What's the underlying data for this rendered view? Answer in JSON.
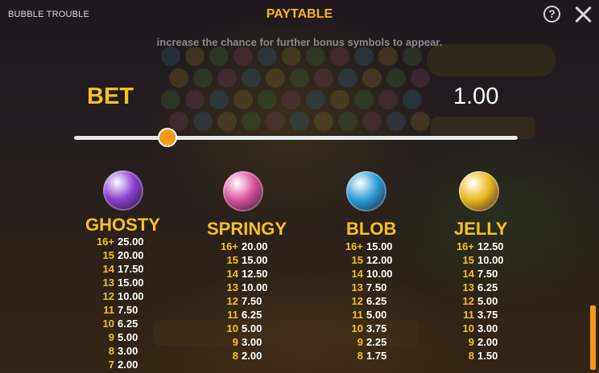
{
  "header": {
    "game_name": "BUBBLE TROUBLE",
    "title": "PAYTABLE",
    "help_label": "?"
  },
  "intro_text": "increase the chance for further bonus symbols to appear.",
  "bet": {
    "label": "BET",
    "value": "1.00",
    "slider_fraction": 0.21
  },
  "symbols": [
    {
      "name": "GHOSTY",
      "icon": "ghosty-icon",
      "color": "#8a3fd0",
      "pays": [
        {
          "count": "16+",
          "pay": "25.00"
        },
        {
          "count": "15",
          "pay": "20.00"
        },
        {
          "count": "14",
          "pay": "17.50"
        },
        {
          "count": "13",
          "pay": "15.00"
        },
        {
          "count": "12",
          "pay": "10.00"
        },
        {
          "count": "11",
          "pay": "7.50"
        },
        {
          "count": "10",
          "pay": "6.25"
        },
        {
          "count": "9",
          "pay": "5.00"
        },
        {
          "count": "8",
          "pay": "3.00"
        },
        {
          "count": "7",
          "pay": "2.00"
        }
      ]
    },
    {
      "name": "SPRINGY",
      "icon": "springy-icon",
      "color": "#d9509a",
      "pays": [
        {
          "count": "16+",
          "pay": "20.00"
        },
        {
          "count": "15",
          "pay": "15.00"
        },
        {
          "count": "14",
          "pay": "12.50"
        },
        {
          "count": "13",
          "pay": "10.00"
        },
        {
          "count": "12",
          "pay": "7.50"
        },
        {
          "count": "11",
          "pay": "6.25"
        },
        {
          "count": "10",
          "pay": "5.00"
        },
        {
          "count": "9",
          "pay": "3.00"
        },
        {
          "count": "8",
          "pay": "2.00"
        }
      ]
    },
    {
      "name": "BLOB",
      "icon": "blob-icon",
      "color": "#2b9bd6",
      "pays": [
        {
          "count": "16+",
          "pay": "15.00"
        },
        {
          "count": "15",
          "pay": "12.00"
        },
        {
          "count": "14",
          "pay": "10.00"
        },
        {
          "count": "13",
          "pay": "7.50"
        },
        {
          "count": "12",
          "pay": "6.25"
        },
        {
          "count": "11",
          "pay": "5.00"
        },
        {
          "count": "10",
          "pay": "3.75"
        },
        {
          "count": "9",
          "pay": "2.25"
        },
        {
          "count": "8",
          "pay": "1.75"
        }
      ]
    },
    {
      "name": "JELLY",
      "icon": "jelly-icon",
      "color": "#e8b81c",
      "pays": [
        {
          "count": "16+",
          "pay": "12.50"
        },
        {
          "count": "15",
          "pay": "10.00"
        },
        {
          "count": "14",
          "pay": "7.50"
        },
        {
          "count": "13",
          "pay": "6.25"
        },
        {
          "count": "12",
          "pay": "5.00"
        },
        {
          "count": "11",
          "pay": "3.75"
        },
        {
          "count": "10",
          "pay": "3.00"
        },
        {
          "count": "9",
          "pay": "2.00"
        },
        {
          "count": "8",
          "pay": "1.50"
        }
      ]
    }
  ],
  "colors": {
    "accent": "#f6c11f",
    "slider_knob": "#f59a14",
    "text": "#ffffff"
  }
}
